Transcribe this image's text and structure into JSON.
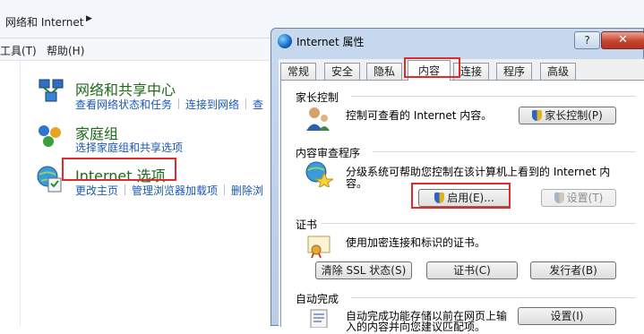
{
  "control_panel": {
    "breadcrumb": "网络和 Internet",
    "menu": [
      "工具(T)",
      "帮助(H)"
    ],
    "categories": [
      {
        "title": "网络和共享中心",
        "links": [
          "查看网络状态和任务",
          "连接到网络",
          "查"
        ]
      },
      {
        "title": "家庭组",
        "links": [
          "选择家庭组和共享选项"
        ]
      },
      {
        "title": "Internet 选项",
        "links": [
          "更改主页",
          "管理浏览器加载项",
          "删除浏"
        ]
      }
    ]
  },
  "dialog": {
    "title": "Internet 属性",
    "help_label": "?",
    "close_label": "✕",
    "tabs": [
      "常规",
      "安全",
      "隐私",
      "内容",
      "连接",
      "程序",
      "高级"
    ],
    "active_tab": "内容",
    "sections": {
      "parental": {
        "title": "家长控制",
        "text": "控制可查看的 Internet 内容。",
        "button": "家长控制(P)"
      },
      "advisor": {
        "title": "内容审查程序",
        "text_line1": "分级系统可帮助您控制在该计算机上看到的 Internet 内",
        "text_line2": "容。",
        "enable_button": "启用(E)...",
        "settings_button": "设置(T)"
      },
      "certificates": {
        "title": "证书",
        "text": "使用加密连接和标识的证书。",
        "clear_ssl_button": "清除 SSL 状态(S)",
        "certs_button": "证书(C)",
        "publishers_button": "发行者(B)"
      },
      "autocomplete": {
        "title": "自动完成",
        "text_line1": "自动完成功能存储以前在网页上输",
        "text_line2": "入的内容并向您建议匹配项。",
        "settings_button": "设置(I)"
      }
    }
  },
  "colors": {
    "highlight": "#e22a2a",
    "category_title": "#1c6a1a",
    "link": "#1a57b6"
  }
}
